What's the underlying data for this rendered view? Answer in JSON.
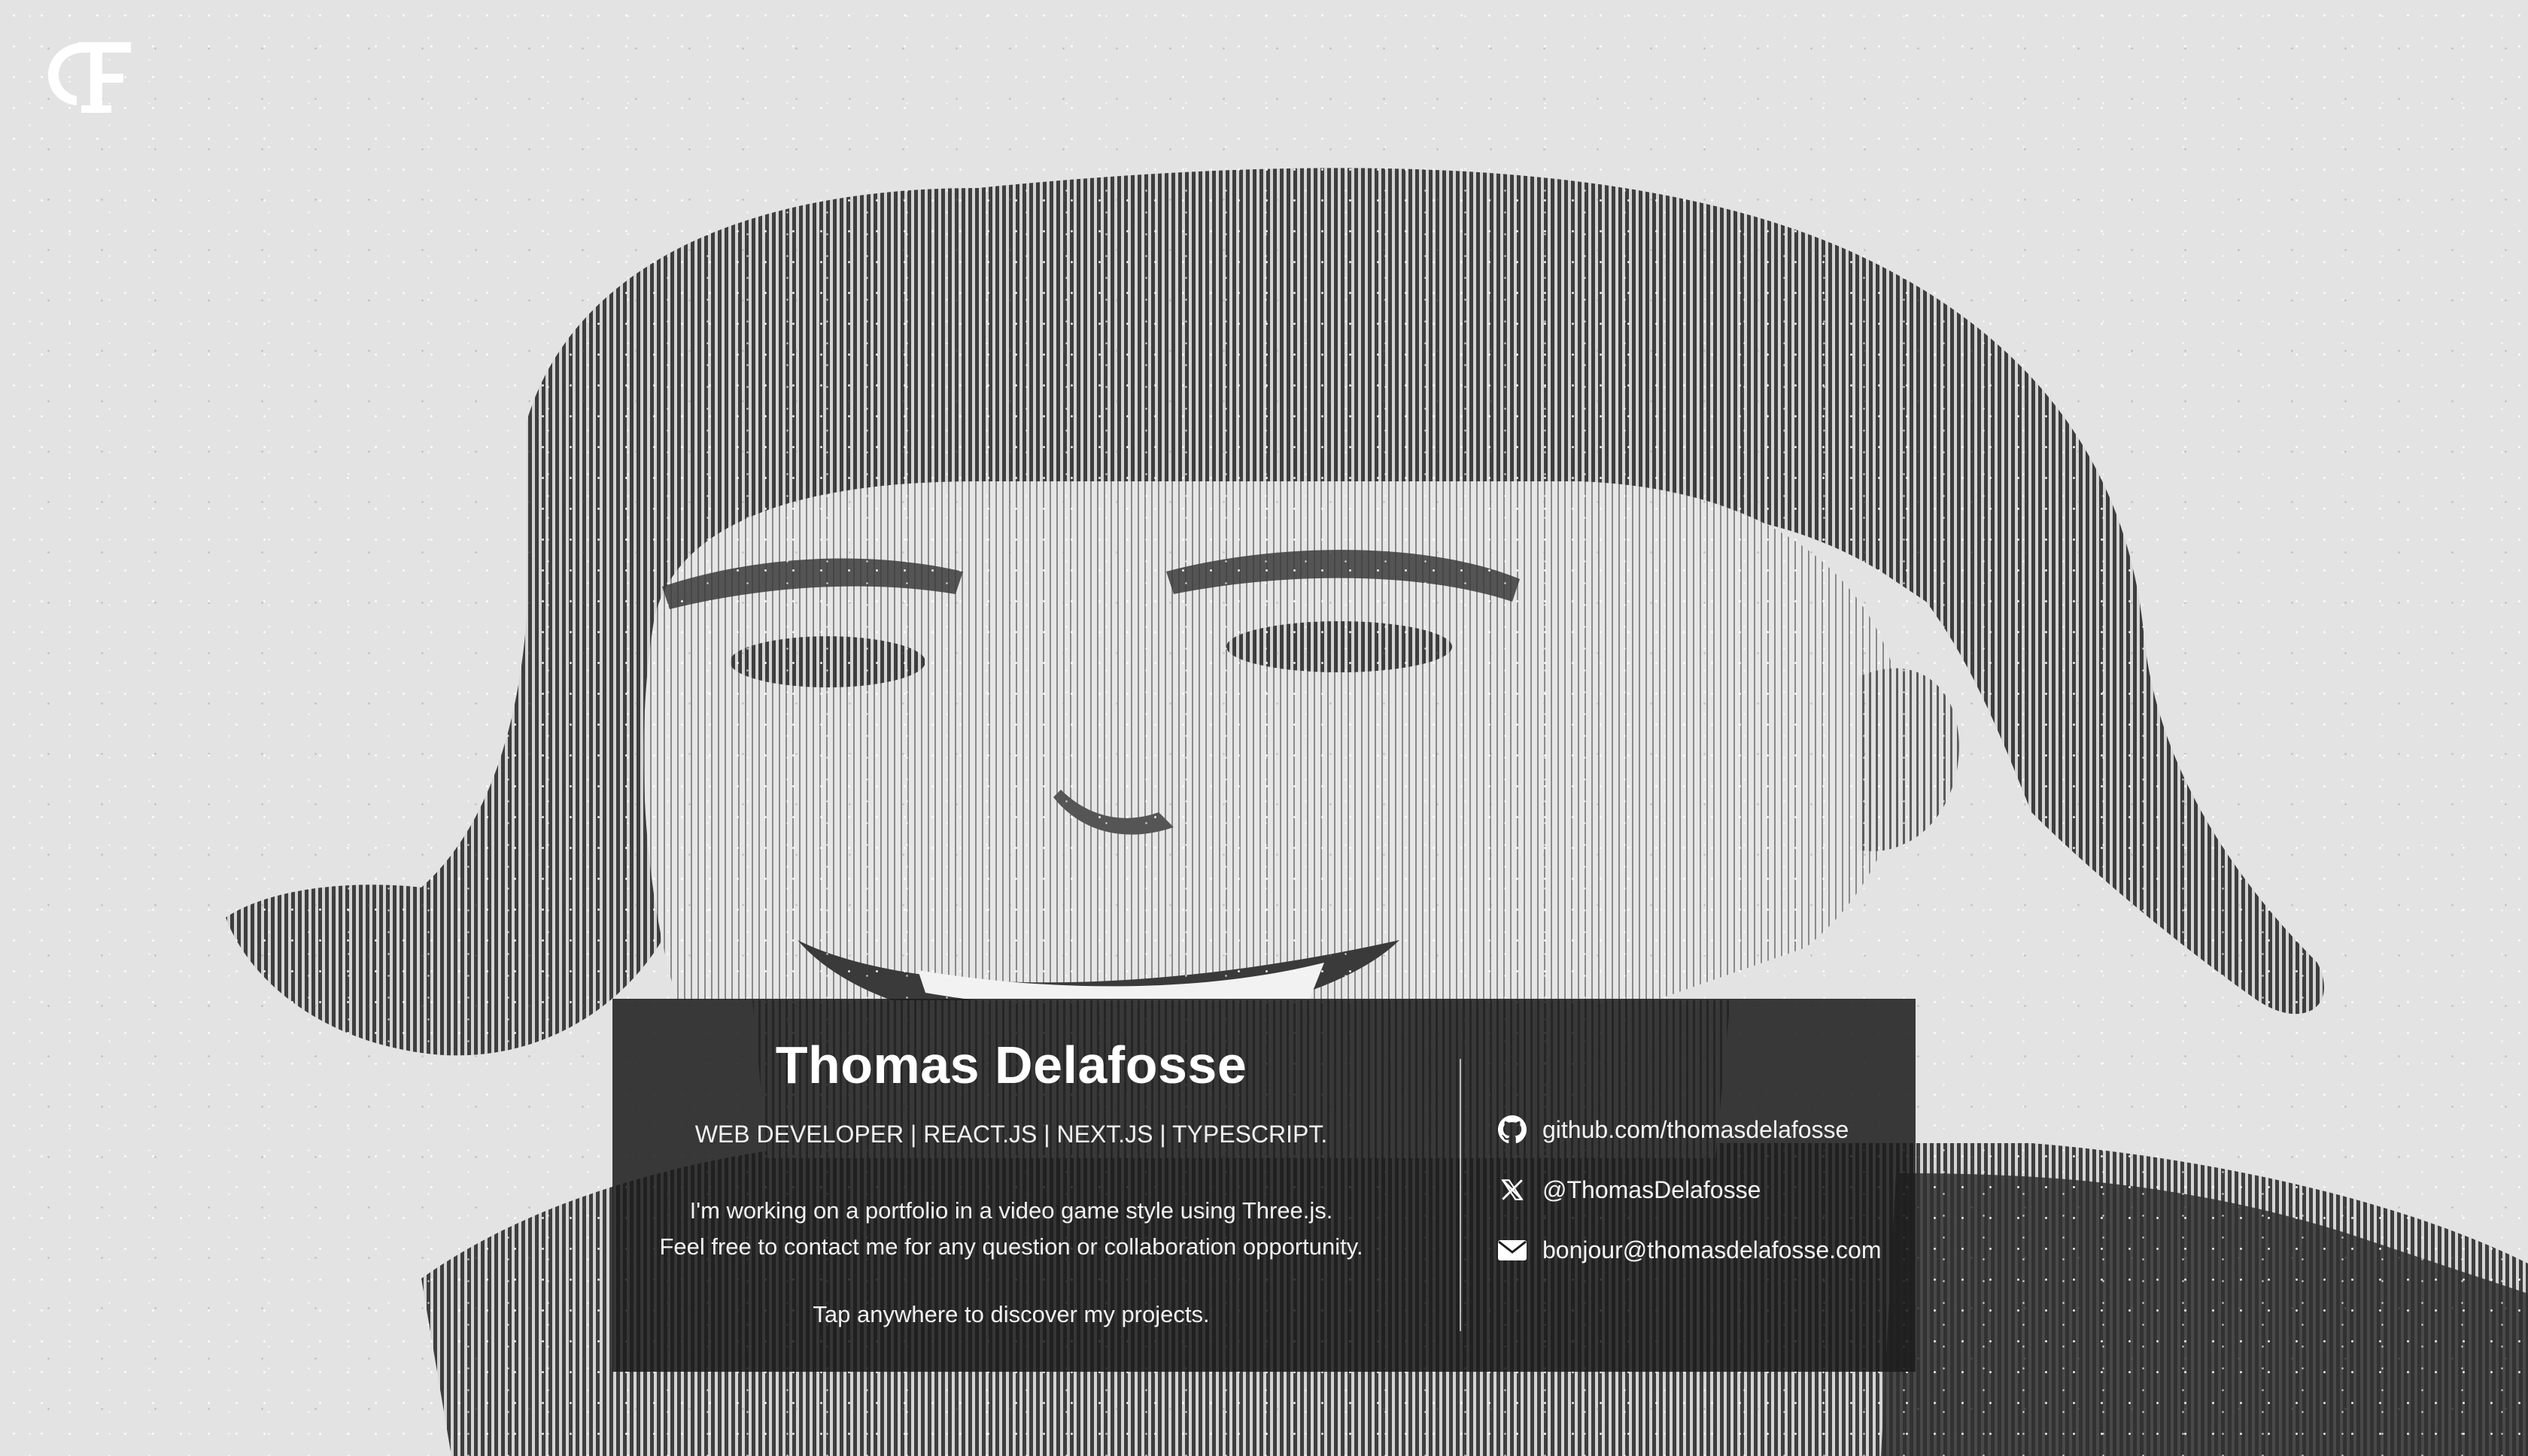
{
  "hero": {
    "name": "Thomas Delafosse",
    "tagline": "WEB DEVELOPER | REACT.JS | NEXT.JS | TYPESCRIPT.",
    "intro_line1": "I'm working on a portfolio in a video game style using Three.js.",
    "intro_line2": "Feel free to contact me for any question or collaboration opportunity.",
    "cta": "Tap anywhere to discover my projects."
  },
  "links": [
    {
      "icon": "github-icon",
      "label": "github.com/thomasdelafosse"
    },
    {
      "icon": "x-icon",
      "label": "@ThomasDelafosse"
    },
    {
      "icon": "mail-icon",
      "label": "bonjour@thomasdelafosse.com"
    }
  ],
  "colors": {
    "background": "#e3e3e3",
    "card": "#1c1c1c",
    "text": "#ffffff"
  }
}
